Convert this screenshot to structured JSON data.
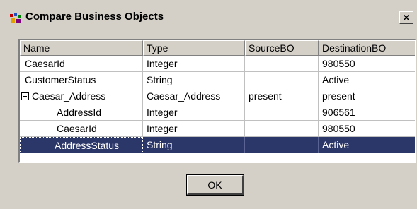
{
  "window": {
    "title": "Compare Business Objects",
    "close_label": "×"
  },
  "table": {
    "columns": [
      "Name",
      "Type",
      "SourceBO",
      "DestinationBO"
    ],
    "rows": [
      {
        "name": "CaesarId",
        "type": "Integer",
        "source": "",
        "destination": "980550",
        "expandable": false,
        "selected": false
      },
      {
        "name": "CustomerStatus",
        "type": "String",
        "source": "",
        "destination": "Active",
        "expandable": false,
        "selected": false
      },
      {
        "name": "Caesar_Address",
        "type": "Caesar_Address",
        "source": "present",
        "destination": "present",
        "expandable": true,
        "expanded": true,
        "selected": false
      },
      {
        "name": "AddressId",
        "type": "Integer",
        "source": "",
        "destination": "906561",
        "expandable": false,
        "selected": false
      },
      {
        "name": "CaesarId",
        "type": "Integer",
        "source": "",
        "destination": "980550",
        "expandable": false,
        "selected": false
      },
      {
        "name": "AddressStatus",
        "type": "String",
        "source": "",
        "destination": "Active",
        "expandable": false,
        "selected": true
      }
    ]
  },
  "buttons": {
    "ok_label": "OK"
  },
  "colors": {
    "selection": "#2b3669",
    "window_bg": "#d4d0c8"
  }
}
